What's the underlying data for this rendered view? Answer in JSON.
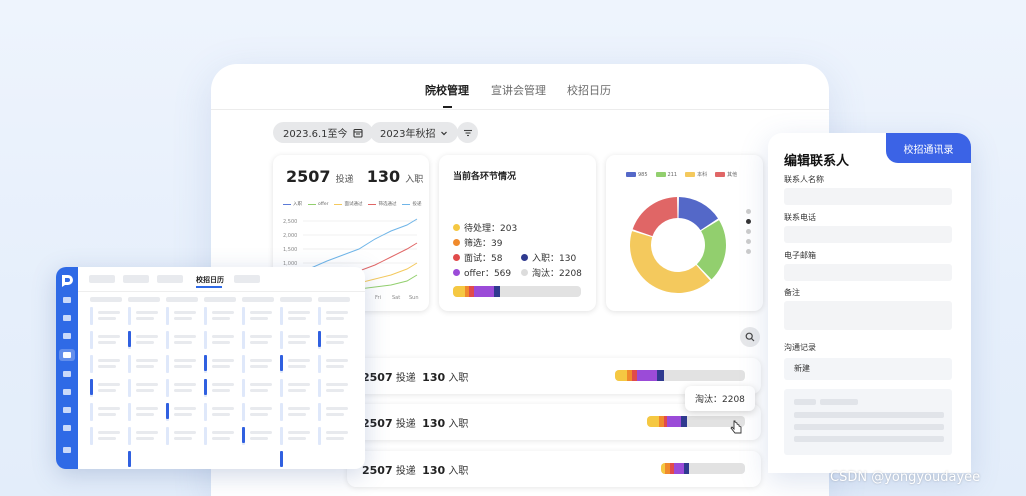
{
  "tabs": [
    "院校管理",
    "宣讲会管理",
    "校招日历"
  ],
  "filters": {
    "date_range": "2023.6.1至今",
    "season": "2023年秋招"
  },
  "summary": {
    "applications": "2507",
    "applications_label": "投递",
    "hires": "130",
    "hires_label": "入职",
    "legend": [
      "入职",
      "offer",
      "面试通过",
      "筛选通过",
      "投递"
    ],
    "y_ticks": [
      "2,500",
      "2,000",
      "1,500",
      "1,000"
    ],
    "x_ticks": [
      "Fri",
      "Sat",
      "Sun"
    ]
  },
  "stages": {
    "title": "当前各环节情况",
    "items": [
      {
        "label": "待处理：203",
        "color": "#f5c842"
      },
      {
        "label": "筛选：39",
        "color": "#f08a2c"
      },
      {
        "label": "面试：58",
        "color": "#e14b4b"
      },
      {
        "label": "入职：130",
        "color": "#2f3a8f"
      },
      {
        "label": "offer：569",
        "color": "#9b4bd8"
      },
      {
        "label": "淘汰：2208",
        "color": "#dcdcdc"
      }
    ]
  },
  "donut": {
    "legend": [
      "985",
      "211",
      "本科",
      "其他"
    ],
    "colors": [
      "#5468c8",
      "#92cf6e",
      "#f4c95d",
      "#e06666"
    ],
    "values": [
      16,
      22,
      42,
      20
    ]
  },
  "rows": [
    {
      "applications": "2507",
      "applications_label": "投递",
      "hires": "130",
      "hires_label": "入职"
    },
    {
      "applications": "2507",
      "applications_label": "投递",
      "hires": "130",
      "hires_label": "入职"
    },
    {
      "applications": "2507",
      "applications_label": "投递",
      "hires": "130",
      "hires_label": "入职"
    }
  ],
  "tooltip": "淘汰：2208",
  "side_panel": {
    "tag": "校招通讯录",
    "title": "编辑联系人",
    "fields": [
      "联系人名称",
      "联系电话",
      "电子邮箱",
      "备注"
    ],
    "log_label": "沟通记录",
    "new_label": "新建"
  },
  "calendar": {
    "tab": "校招日历"
  },
  "watermark": "CSDN @yongyoudayee"
}
